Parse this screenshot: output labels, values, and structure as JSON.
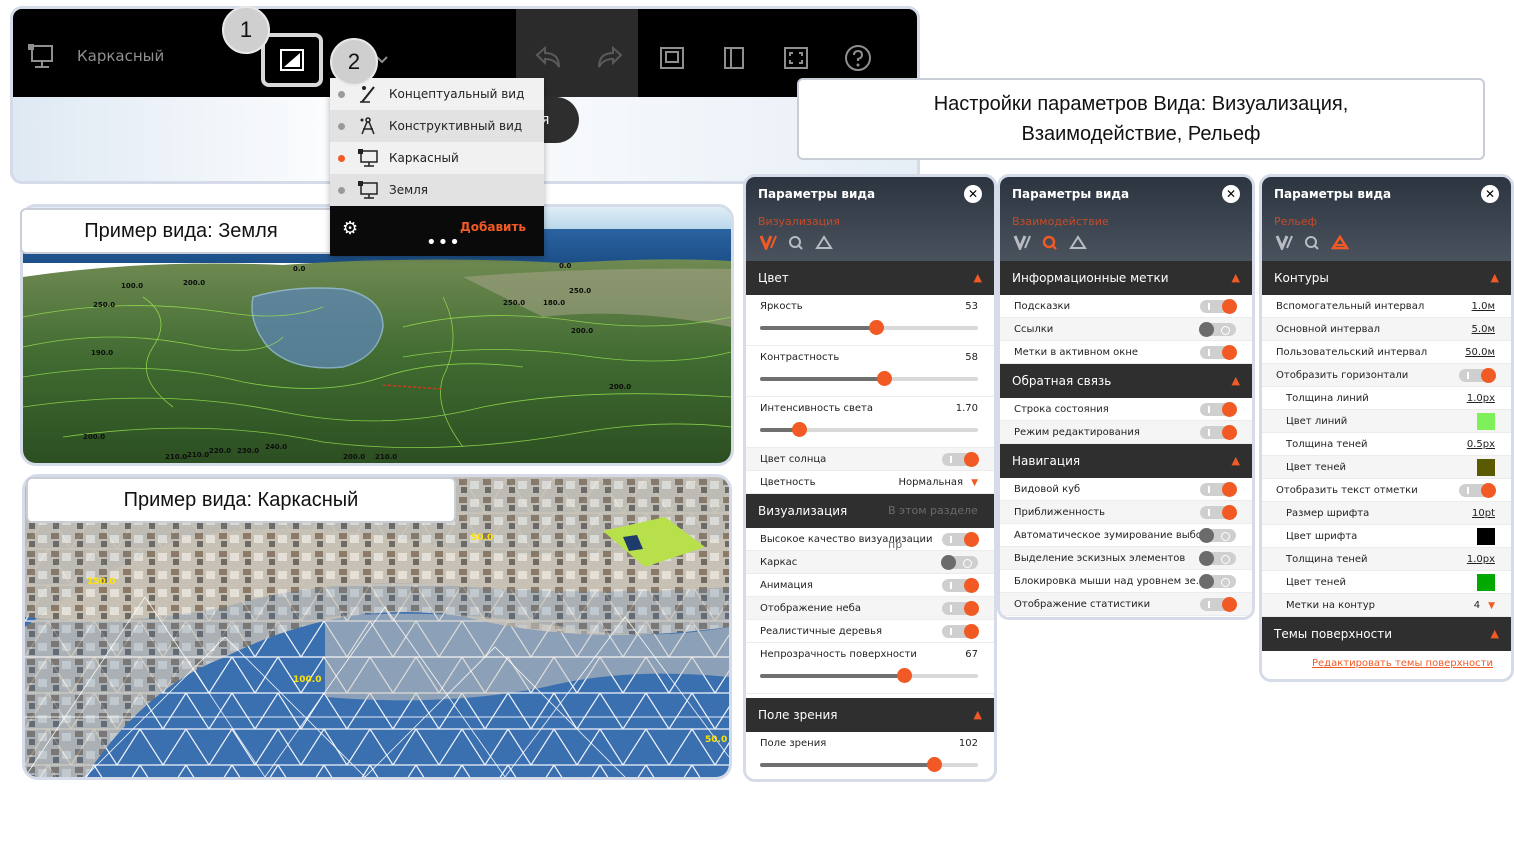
{
  "toolbar": {
    "title": "Каркасный",
    "badge1": "1",
    "badge2": "2",
    "pill_text": "я"
  },
  "dropdown": {
    "items": [
      {
        "label": "Концептуальный вид",
        "active": false
      },
      {
        "label": "Конструктивный вид",
        "active": false
      },
      {
        "label": "Каркасный",
        "active": true
      },
      {
        "label": "Земля",
        "active": false
      }
    ],
    "add_label": "Добавить",
    "more_label": "•••"
  },
  "captions": {
    "settings": "Настройки параметров Вида: Визуализация, Взаимодействие, Рельеф",
    "earth": "Пример вида: Земля",
    "wireframe": "Пример вида: Каркасный"
  },
  "earth_labels": [
    "100.0",
    "200.0",
    "0.0",
    "250.0",
    "250.0",
    "200.0",
    "190.0",
    "210.0",
    "200.0",
    "200.0",
    "210.0",
    "220.0",
    "230.0",
    "240.0",
    "200.0",
    "210.0",
    "180.0",
    "250.0",
    "0.0"
  ],
  "wire_labels": [
    "150.0",
    "50.0",
    "100.0",
    "50.0"
  ],
  "panel_visual": {
    "title": "Параметры вида",
    "subtitle": "Визуализация",
    "sections": {
      "color": "Цвет",
      "visual": "Визуализация",
      "visual_hint": "В этом разделе пр",
      "fov": "Поле зрения"
    },
    "sliders": [
      {
        "label": "Яркость",
        "value": "53",
        "fraction": 0.53
      },
      {
        "label": "Контрастность",
        "value": "58",
        "fraction": 0.57
      },
      {
        "label": "Интенсивность света",
        "value": "1.70",
        "fraction": 0.18
      }
    ],
    "sun_color": "Цвет солнца",
    "chroma_label": "Цветность",
    "chroma_value": "Нормальная",
    "visual_toggles": [
      {
        "label": "Высокое качество визуализации",
        "on": true
      },
      {
        "label": "Каркас",
        "on": false
      },
      {
        "label": "Анимация",
        "on": true
      },
      {
        "label": "Отображение неба",
        "on": true
      },
      {
        "label": "Реалистичные деревья",
        "on": true
      }
    ],
    "opacity": {
      "label": "Непрозрачность поверхности",
      "value": "67",
      "fraction": 0.66
    },
    "fov": {
      "label": "Поле зрения",
      "value": "102",
      "fraction": 0.8
    }
  },
  "panel_interact": {
    "title": "Параметры вида",
    "subtitle": "Взаимодействие",
    "sections": {
      "labels": "Информационные метки",
      "feedback": "Обратная связь",
      "nav": "Навигация"
    },
    "labels_rows": [
      {
        "label": "Подсказки",
        "on": true
      },
      {
        "label": "Ссылки",
        "on": false
      },
      {
        "label": "Метки в активном окне",
        "on": true
      }
    ],
    "feedback_rows": [
      {
        "label": "Строка состояния",
        "on": true
      },
      {
        "label": "Режим редактирования",
        "on": true
      }
    ],
    "nav_rows": [
      {
        "label": "Видовой куб",
        "on": true
      },
      {
        "label": "Приближенность",
        "on": true
      },
      {
        "label": "Автоматическое зумирование выбо...",
        "on": false
      },
      {
        "label": "Выделение эскизных элементов",
        "on": false
      },
      {
        "label": "Блокировка мыши над уровнем зе...",
        "on": false
      },
      {
        "label": "Отображение статистики",
        "on": true
      }
    ]
  },
  "panel_relief": {
    "title": "Параметры вида",
    "subtitle": "Рельеф",
    "sections": {
      "contours": "Контуры",
      "themes": "Темы поверхности"
    },
    "rows": [
      {
        "label": "Вспомогательный интервал",
        "value": "1.0м",
        "kind": "value"
      },
      {
        "label": "Основной интервал",
        "value": "5.0м",
        "kind": "value"
      },
      {
        "label": "Пользовательский интервал",
        "value": "50.0м",
        "kind": "value"
      },
      {
        "label": "Отобразить горизонтали",
        "kind": "toggle"
      },
      {
        "label": "Толщина линий",
        "value": "1.0px",
        "kind": "value",
        "indent": true
      },
      {
        "label": "Цвет линий",
        "kind": "swatch",
        "color": "#7ef05a",
        "indent": true
      },
      {
        "label": "Толщина теней",
        "value": "0.5px",
        "kind": "value",
        "indent": true
      },
      {
        "label": "Цвет теней",
        "kind": "swatch",
        "color": "#5a5a00",
        "indent": true
      },
      {
        "label": "Отобразить текст отметки",
        "kind": "toggle"
      },
      {
        "label": "Размер шрифта",
        "value": "10pt",
        "kind": "value",
        "indent": true
      },
      {
        "label": "Цвет шрифта",
        "kind": "swatch",
        "color": "#000000",
        "indent": true
      },
      {
        "label": "Толщина теней",
        "value": "1.0px",
        "kind": "value",
        "indent": true
      },
      {
        "label": "Цвет теней",
        "kind": "swatch",
        "color": "#00a800",
        "indent": true
      },
      {
        "label": "Метки на контур",
        "value": "4",
        "kind": "dropdown",
        "indent": true
      }
    ],
    "edit_link": "Редактировать темы поверхности"
  },
  "accent_color": "#f15a24"
}
